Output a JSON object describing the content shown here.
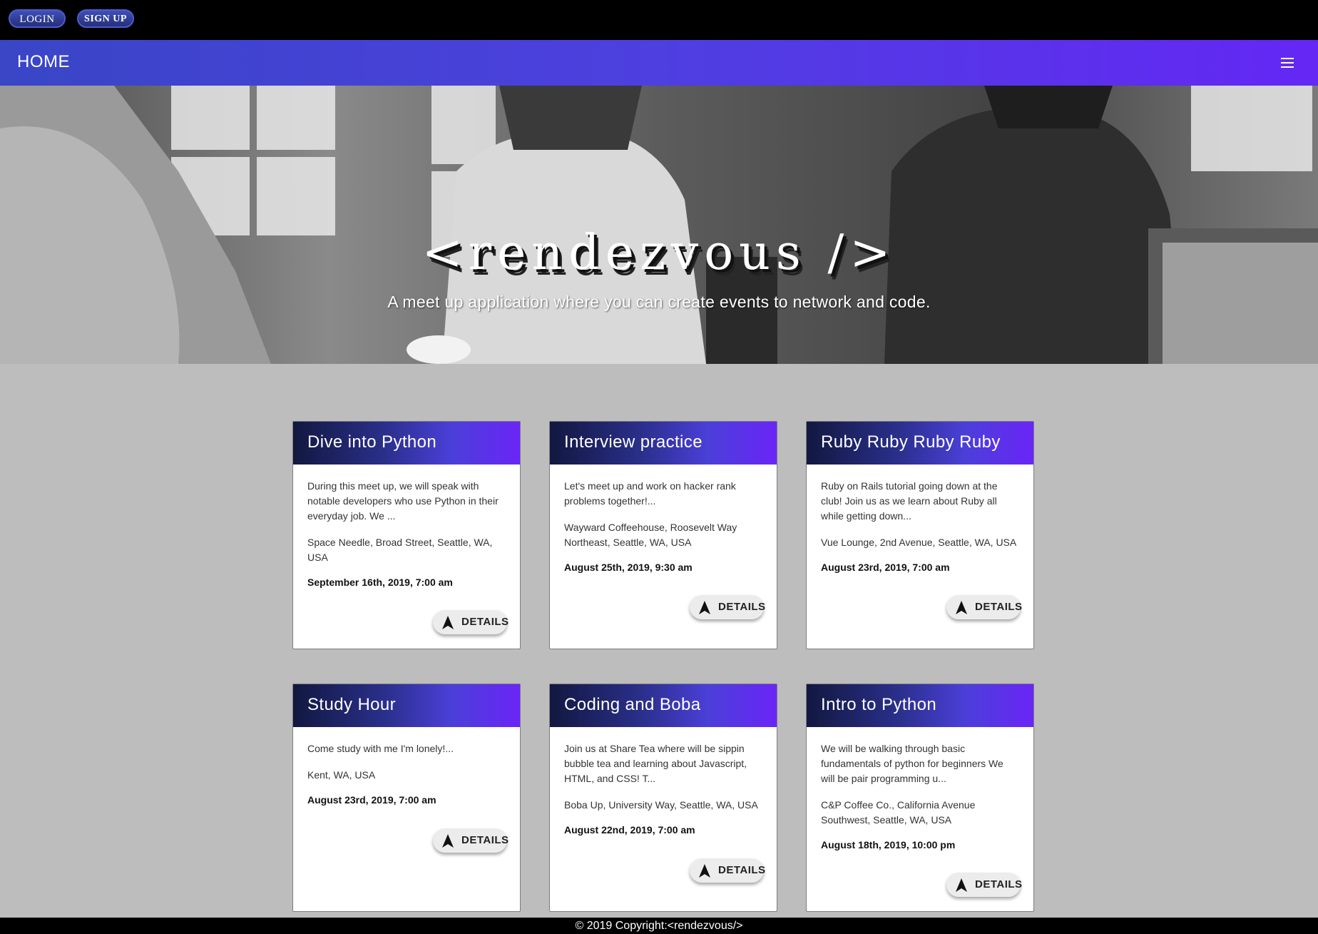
{
  "auth": {
    "login_label": "LOGIN",
    "signup_label": "SIGN UP"
  },
  "nav": {
    "home_label": "HOME",
    "menu_icon": "hamburger-menu-icon"
  },
  "hero": {
    "title": "<rendezvous />",
    "subtitle": "A meet up application where you can create events to network and code."
  },
  "colors": {
    "nav_gradient_start": "#3946c6",
    "nav_gradient_end": "#6427f4",
    "page_background": "#bdbdbd",
    "card_header_start": "#121840",
    "card_header_end": "#6a25f7"
  },
  "events": [
    {
      "title": "Dive into Python",
      "description": "During this meet up, we will speak with notable developers who use Python in their everyday job. We ...",
      "location": "Space Needle, Broad Street, Seattle, WA, USA",
      "date": "September 16th, 2019, 7:00 am",
      "button_label": "DETAILS"
    },
    {
      "title": "Interview practice",
      "description": "Let's meet up and work on hacker rank problems together!...",
      "location": "Wayward Coffeehouse, Roosevelt Way Northeast, Seattle, WA, USA",
      "date": "August 25th, 2019, 9:30 am",
      "button_label": "DETAILS"
    },
    {
      "title": "Ruby Ruby Ruby Ruby",
      "description": "Ruby on Rails tutorial going down at the club! Join us as we learn about Ruby all while getting down...",
      "location": "Vue Lounge, 2nd Avenue, Seattle, WA, USA",
      "date": "August 23rd, 2019, 7:00 am",
      "button_label": "DETAILS"
    },
    {
      "title": "Study Hour",
      "description": "Come study with me I'm lonely!...",
      "location": "Kent, WA, USA",
      "date": "August 23rd, 2019, 7:00 am",
      "button_label": "DETAILS"
    },
    {
      "title": "Coding and Boba",
      "description": "Join us at Share Tea where will be sippin bubble tea and learning about Javascript, HTML, and CSS! T...",
      "location": "Boba Up, University Way, Seattle, WA, USA",
      "date": "August 22nd, 2019, 7:00 am",
      "button_label": "DETAILS"
    },
    {
      "title": "Intro to Python",
      "description": "We will be walking through basic fundamentals of python for beginners We will be pair programming u...",
      "location": "C&P Coffee Co., California Avenue Southwest, Seattle, WA, USA",
      "date": "August 18th, 2019, 10:00 pm",
      "button_label": "DETAILS"
    }
  ],
  "footer": {
    "text": "© 2019 Copyright:<rendezvous/>"
  }
}
